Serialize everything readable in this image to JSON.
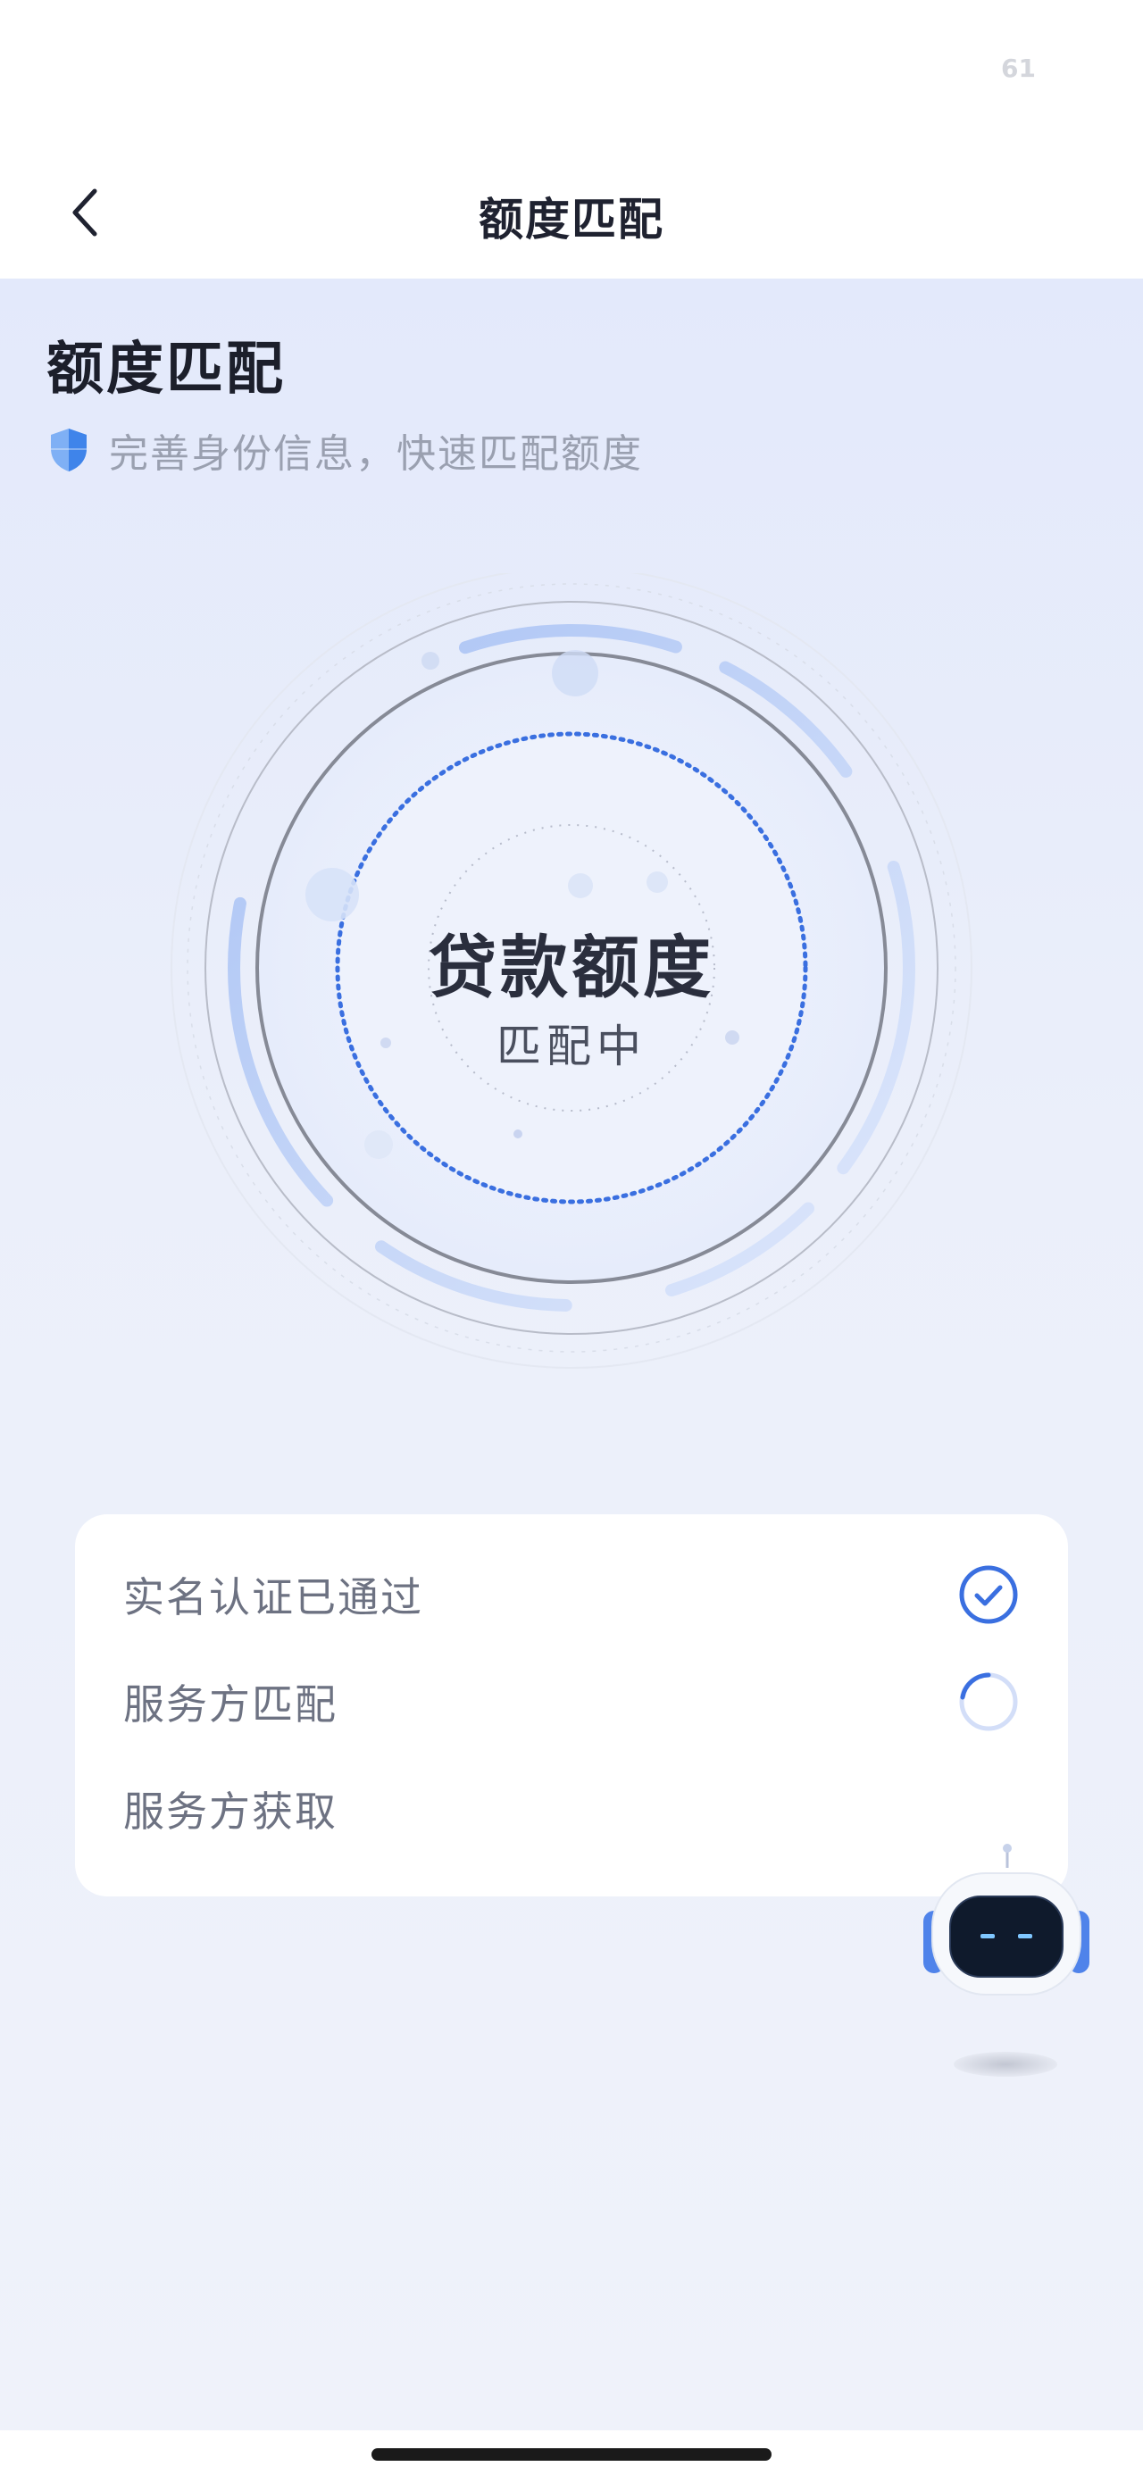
{
  "status_bar": {
    "battery": "61"
  },
  "nav": {
    "title": "额度匹配",
    "back_icon": "chevron-left-icon"
  },
  "header": {
    "heading": "额度匹配",
    "subtitle": "完善身份信息，快速匹配额度",
    "shield_icon": "shield-icon"
  },
  "gauge": {
    "title": "贷款额度",
    "status": "匹配中"
  },
  "steps": [
    {
      "label": "实名认证已通过",
      "state": "done",
      "icon": "check-circle-icon"
    },
    {
      "label": "服务方匹配",
      "state": "loading",
      "icon": "spinner-icon"
    },
    {
      "label": "服务方获取",
      "state": "pending",
      "icon": ""
    }
  ],
  "assistant": {
    "icon": "robot-assistant-icon"
  },
  "colors": {
    "accent": "#3a6fe0",
    "background_top": "#e3e9fb",
    "background_bottom": "#eff2fa",
    "text_primary": "#1c1f2b",
    "text_secondary": "#9aa0b0"
  }
}
